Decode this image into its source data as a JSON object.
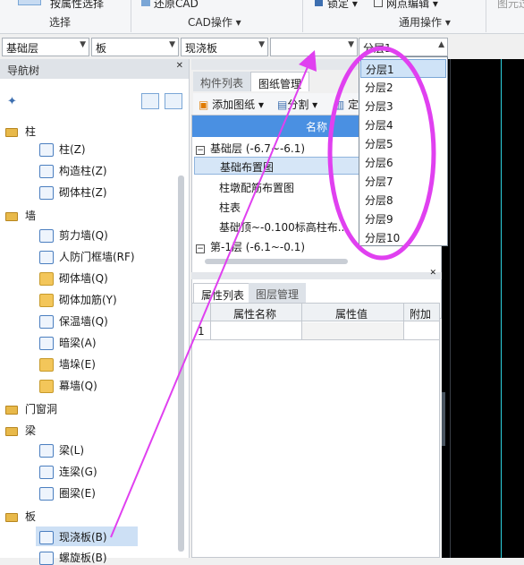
{
  "ribbon": {
    "btn_attr_select": "按属性选择",
    "btn_restore_cad": "还原CAD",
    "btn_lock": "锁定",
    "btn_grid_edit": "网点编辑",
    "btn_image": "图元过",
    "group_select": "选择",
    "group_cad": "CAD操作",
    "group_common": "通用操作"
  },
  "combos": {
    "floor": "基础层",
    "type": "板",
    "element": "现浇板",
    "blank": "",
    "layer": "分层1"
  },
  "nav": {
    "title": "导航树",
    "groups": {
      "column": "柱",
      "wall": "墙",
      "opening": "门窗洞",
      "beam": "梁",
      "slab": "板"
    },
    "items": {
      "col_z": "柱(Z)",
      "col_gz": "构造柱(Z)",
      "col_qtz": "砌体柱(Z)",
      "wall_jlq": "剪力墙(Q)",
      "wall_rfmkq": "人防门框墙(RF)",
      "wall_qtq": "砌体墙(Q)",
      "wall_qtjj": "砌体加筋(Y)",
      "wall_bwq": "保温墙(Q)",
      "wall_al": "暗梁(A)",
      "wall_qd": "墙垛(E)",
      "wall_mq": "幕墙(Q)",
      "beam_l": "梁(L)",
      "beam_ll": "连梁(G)",
      "beam_ql": "圈梁(E)",
      "slab_xjb": "现浇板(B)",
      "slab_lxb": "螺旋板(B)"
    }
  },
  "mid": {
    "tab_component": "构件列表",
    "tab_drawing": "图纸管理",
    "btn_add_drawing": "添加图纸",
    "btn_split": "分割",
    "btn_locate": "定",
    "col_name": "名称",
    "rows": [
      "基础层 (-6.7~-6.1)",
      "基础布置图",
      "柱墩配筋布置图",
      "柱表",
      "基础顶~-0.100标高柱布...",
      "第-1层 (-6.1~-0.1)"
    ],
    "tab_props": "属性列表",
    "tab_layers": "图层管理",
    "prop_headers": [
      "属性名称",
      "属性值",
      "附加"
    ],
    "prop_row1": "1"
  },
  "dropdown": {
    "options": [
      "分层1",
      "分层2",
      "分层3",
      "分层4",
      "分层5",
      "分层6",
      "分层7",
      "分层8",
      "分层9",
      "分层10"
    ],
    "selected": "分层1"
  },
  "annotation": {
    "arrow_color": "#e040f0",
    "ellipse_color": "#e040f0"
  }
}
